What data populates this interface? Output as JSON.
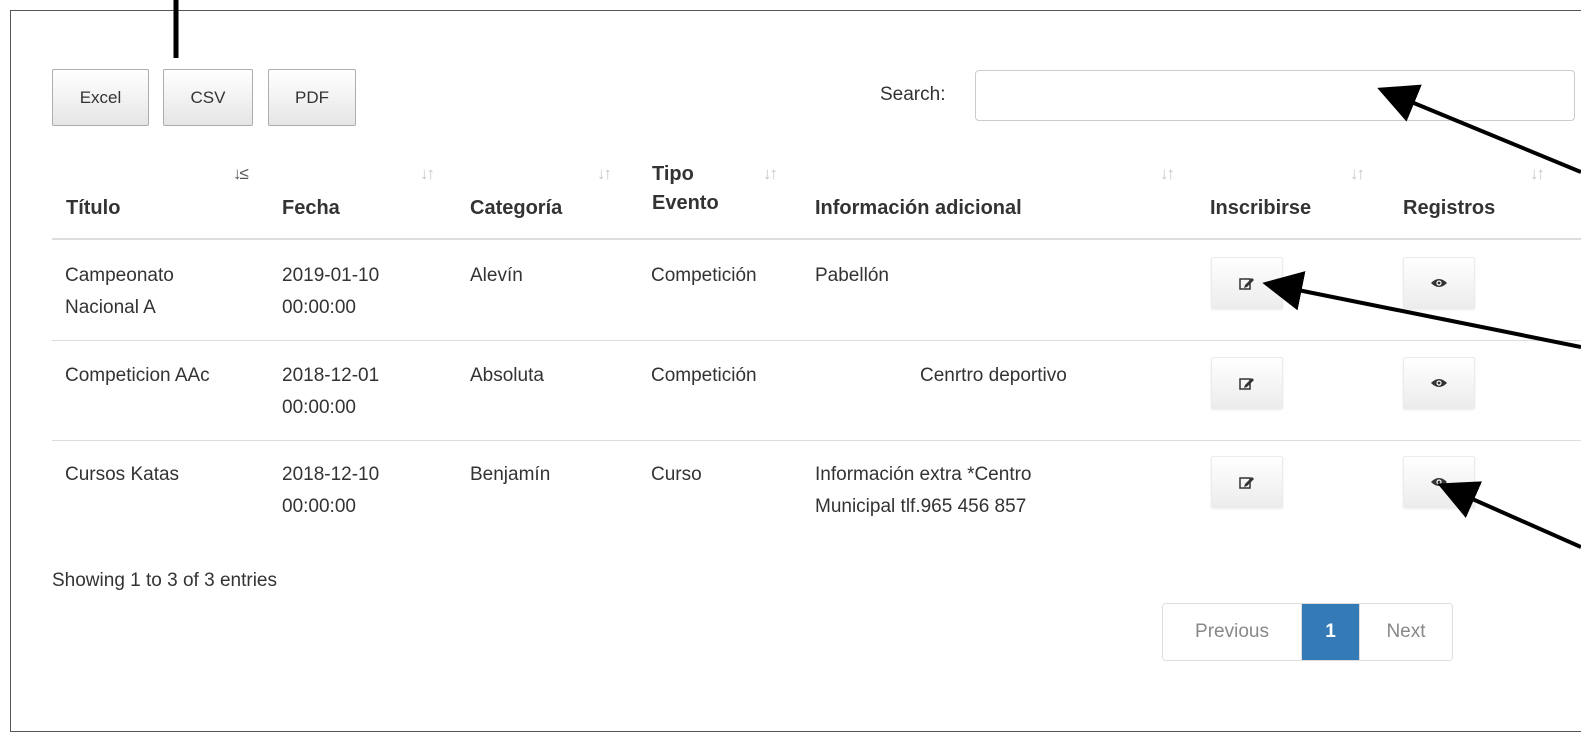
{
  "toolbar": {
    "excel": "Excel",
    "csv": "CSV",
    "pdf": "PDF"
  },
  "search": {
    "label": "Search:",
    "value": "",
    "placeholder": ""
  },
  "columns": [
    "Título",
    "Fecha",
    "Categoría",
    "Tipo",
    "Evento",
    "Información adicional",
    "Inscribirse",
    "Registros"
  ],
  "rows": [
    {
      "titulo": [
        "Campeonato",
        "Nacional A"
      ],
      "fecha": [
        "2019-01-10",
        "00:00:00"
      ],
      "categoria": "Alevín",
      "tipo": "Competición",
      "info": [
        "Pabellón"
      ]
    },
    {
      "titulo": [
        "Competicion AAc"
      ],
      "fecha": [
        "2018-12-01",
        "00:00:00"
      ],
      "categoria": "Absoluta",
      "tipo": "Competición",
      "info": [
        "Cenrtro deportivo"
      ]
    },
    {
      "titulo": [
        "Cursos Katas"
      ],
      "fecha": [
        "2018-12-10",
        "00:00:00"
      ],
      "categoria": "Benjamín",
      "tipo": "Curso",
      "info": [
        "Información extra *Centro",
        "Municipal tlf.965 456 857"
      ]
    }
  ],
  "footer": {
    "info": "Showing 1 to 3 of 3 entries"
  },
  "pagination": {
    "previous": "Previous",
    "current": "1",
    "next": "Next"
  },
  "icons": {
    "edit": "edit-icon",
    "view": "eye-icon",
    "sort": "sort-icon",
    "sort_active": "sort-asc-icon"
  }
}
